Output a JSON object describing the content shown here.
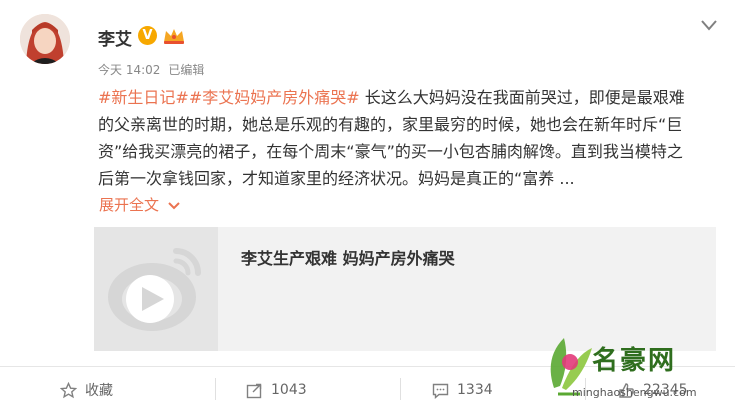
{
  "post": {
    "username": "李艾",
    "verified_badge": "V",
    "time": "今天 14:02",
    "edited": "已编辑",
    "tags": [
      "#新生日记#",
      "#李艾妈妈产房外痛哭#"
    ],
    "body": "长这么大妈妈没在我面前哭过，即便是最艰难的父亲离世的时期，她总是乐观的有趣的，家里最穷的时候，她也会在新年时斥“巨资”给我买漂亮的裙子，在每个周末“豪气”的买一小包杏脯肉解馋。直到我当模特之后第一次拿钱回家，才知道家里的经济状况。妈妈是真正的“富养 ...",
    "expand_label": "展开全文"
  },
  "video_card": {
    "title": "李艾生产艰难 妈妈产房外痛哭"
  },
  "actions": {
    "favorite_label": "收藏",
    "repost_count": "1043",
    "comment_count": "1334",
    "like_count": "22345"
  },
  "watermark": {
    "name": "名豪网",
    "url": "minghaoshengwu.com"
  },
  "colors": {
    "accent": "#eb7350",
    "text": "#333333",
    "meta": "#888888",
    "card_bg": "#f2f2f2"
  }
}
